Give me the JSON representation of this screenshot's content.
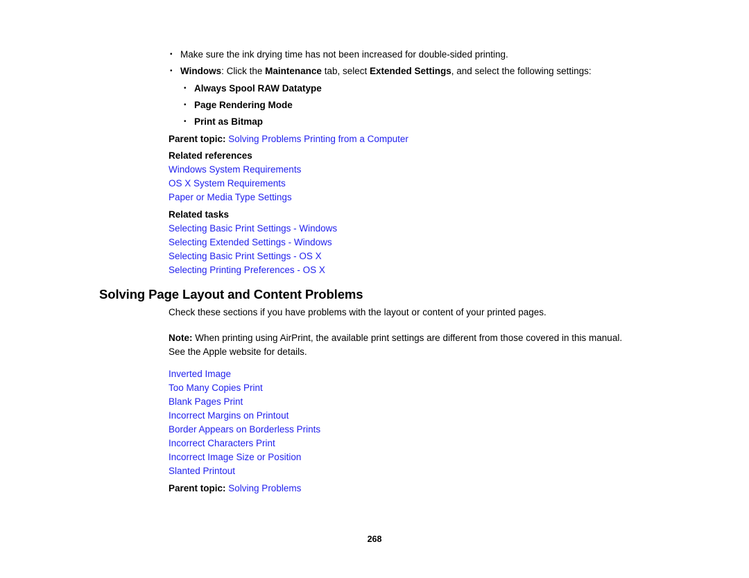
{
  "document": {
    "page_number": "268",
    "link_color": "#2222ee",
    "text_color": "#000000",
    "background_color": "#ffffff"
  },
  "intro_bullets": [
    {
      "segments": [
        {
          "text": "Make sure the ink drying time has not been increased for double-sided printing.",
          "bold": false
        }
      ]
    },
    {
      "segments": [
        {
          "text": "Windows",
          "bold": true
        },
        {
          "text": ": Click the ",
          "bold": false
        },
        {
          "text": "Maintenance",
          "bold": true
        },
        {
          "text": " tab, select ",
          "bold": false
        },
        {
          "text": "Extended Settings",
          "bold": true
        },
        {
          "text": ", and select the following settings:",
          "bold": false
        }
      ]
    }
  ],
  "sub_bullets": [
    "Always Spool RAW Datatype",
    "Page Rendering Mode",
    "Print as Bitmap"
  ],
  "parent_topic_1": {
    "label": "Parent topic:",
    "link": "Solving Problems Printing from a Computer"
  },
  "related_references": {
    "heading": "Related references",
    "links": [
      "Windows System Requirements",
      "OS X System Requirements",
      "Paper or Media Type Settings"
    ]
  },
  "related_tasks": {
    "heading": "Related tasks",
    "links": [
      "Selecting Basic Print Settings - Windows",
      "Selecting Extended Settings - Windows",
      "Selecting Basic Print Settings - OS X",
      "Selecting Printing Preferences - OS X"
    ]
  },
  "section": {
    "heading": "Solving Page Layout and Content Problems",
    "intro_paragraph": "Check these sections if you have problems with the layout or content of your printed pages.",
    "note": {
      "label": "Note:",
      "text": " When printing using AirPrint, the available print settings are different from those covered in this manual. See the Apple website for details."
    },
    "topic_links": [
      "Inverted Image",
      "Too Many Copies Print",
      "Blank Pages Print",
      "Incorrect Margins on Printout",
      "Border Appears on Borderless Prints",
      "Incorrect Characters Print",
      "Incorrect Image Size or Position",
      "Slanted Printout"
    ]
  },
  "parent_topic_2": {
    "label": "Parent topic:",
    "link": "Solving Problems"
  }
}
